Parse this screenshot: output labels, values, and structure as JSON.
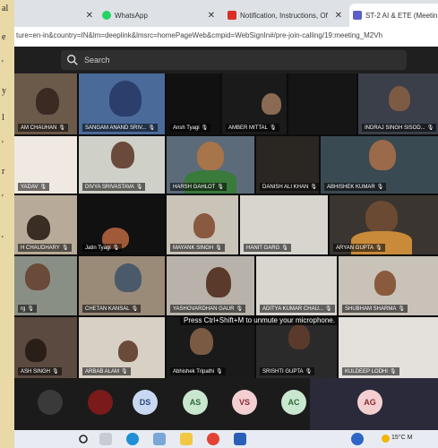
{
  "doc_margin": [
    "al",
    "e",
    "'",
    "y",
    "l",
    "'",
    "r",
    "'",
    "'"
  ],
  "browser": {
    "tabs": [
      {
        "label": "",
        "favicon_color": "#9aa0a6"
      },
      {
        "label": "WhatsApp",
        "favicon_color": "#25d366"
      },
      {
        "label": "Notification, Instructions, Of",
        "favicon_color": "#d93025"
      },
      {
        "label": "ST-2 AI & ETE (Meetin",
        "favicon_color": "#5b5fc7"
      }
    ],
    "url": "ture=en-in&country=IN&lm=deeplink&lmsrc=homePageWeb&cmpid=WebSignIn#/pre-join-calling/19:meeting_M2Vh"
  },
  "teams": {
    "search_placeholder": "Search",
    "participants": [
      {
        "name": "AM CHAUHAN"
      },
      {
        "name": "SANGAM ANAND SRIV..."
      },
      {
        "name": "Ansh Tyagi"
      },
      {
        "name": "AMBER MITTAL"
      },
      {
        "name": "INDRAJ SINGH SISOD..."
      },
      {
        "name": "YADAV"
      },
      {
        "name": "DIVYA SRIVASTAVA"
      },
      {
        "name": "HARSH GAHLOT"
      },
      {
        "name": "DANISH ALI KHAN"
      },
      {
        "name": "ABHISHEK KUMAR"
      },
      {
        "name": "H CHAUDHARY"
      },
      {
        "name": "Jatin Tyagi"
      },
      {
        "name": "MAYANK SINGH"
      },
      {
        "name": "HANIT GARG"
      },
      {
        "name": "ARYAN GUPTA"
      },
      {
        "name": "rg"
      },
      {
        "name": "CHETAN KANSAL"
      },
      {
        "name": "YASHOVARDHAN GAUR"
      },
      {
        "name": "ADITYA KUMAR CHAU..."
      },
      {
        "name": "SHUBHAM SHARMA"
      },
      {
        "name": "ASH SINGH"
      },
      {
        "name": "ARBAB ALAM"
      },
      {
        "name": "Abhishek Tripathi"
      },
      {
        "name": "SRISHTI GUPTA"
      },
      {
        "name": "KULDEEP LODHI"
      }
    ],
    "toast": "Press Ctrl+Shift+M to unmute your microphone.",
    "roster": [
      {
        "initials": "",
        "color": "#3a3a3a"
      },
      {
        "initials": "",
        "color": "#7a1a1a"
      },
      {
        "initials": "DS",
        "color": "#c7d8f0",
        "text": "#2b4a7a"
      },
      {
        "initials": "AS",
        "color": "#c9e7cf",
        "text": "#2d6a3a"
      },
      {
        "initials": "VS",
        "color": "#f4cfd2",
        "text": "#8a2a34"
      },
      {
        "initials": "AC",
        "color": "#c9e7cf",
        "text": "#2d6a3a"
      },
      {
        "initials": "AG",
        "color": "#f4cfd2",
        "text": "#8a2a34"
      }
    ]
  },
  "taskbar": {
    "weather": "15°C M"
  }
}
